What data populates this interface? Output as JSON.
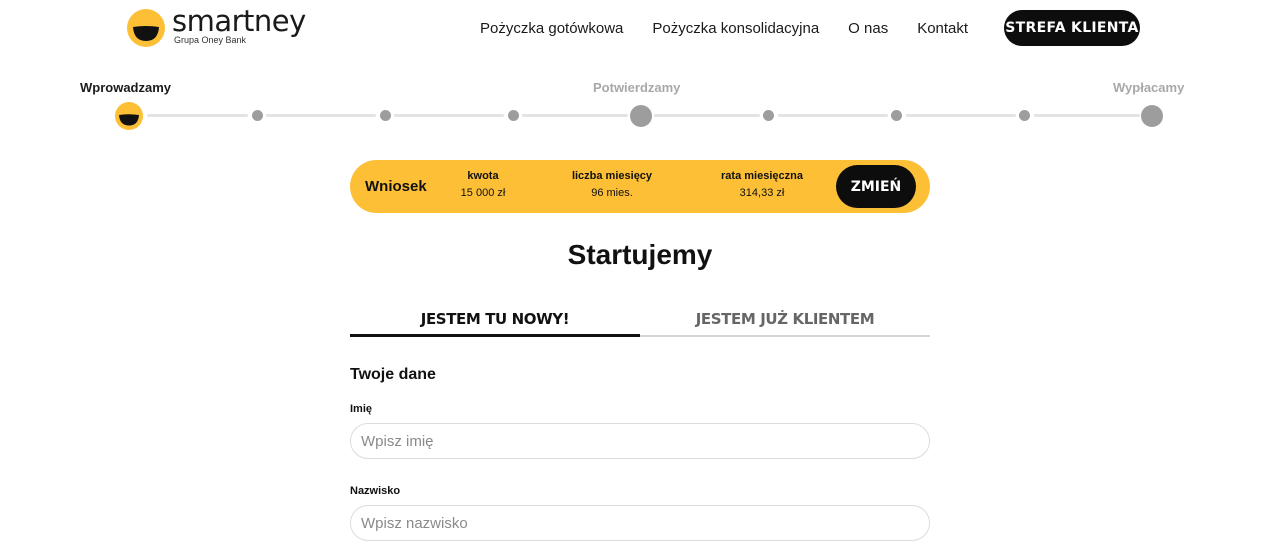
{
  "brand": {
    "name": "smartney",
    "subtitle": "Grupa Oney Bank",
    "color": "#fcbf36"
  },
  "nav": {
    "items": [
      {
        "label": "Pożyczka gotówkowa"
      },
      {
        "label": "Pożyczka konsolidacyjna"
      },
      {
        "label": "O nas"
      },
      {
        "label": "Kontakt"
      }
    ],
    "client_button": "STREFA KLIENTA"
  },
  "stepper": {
    "steps": [
      {
        "label": "Wprowadzamy",
        "state": "active"
      },
      {
        "label": "Potwierdzamy",
        "state": "upcoming"
      },
      {
        "label": "Wypłacamy",
        "state": "upcoming"
      }
    ]
  },
  "summary": {
    "title": "Wniosek",
    "amount_label": "kwota",
    "amount_value": "15 000 zł",
    "months_label": "liczba miesięcy",
    "months_value": "96 mies.",
    "rate_label": "rata miesięczna",
    "rate_value": "314,33 zł",
    "change_button": "ZMIEŃ"
  },
  "page": {
    "heading": "Startujemy"
  },
  "tabs": [
    {
      "label": "JESTEM TU NOWY!",
      "active": true
    },
    {
      "label": "JESTEM JUŻ KLIENTEM",
      "active": false
    }
  ],
  "form": {
    "section_title": "Twoje dane",
    "first_name": {
      "label": "Imię",
      "placeholder": "Wpisz imię",
      "value": ""
    },
    "last_name": {
      "label": "Nazwisko",
      "placeholder": "Wpisz nazwisko",
      "value": ""
    }
  }
}
